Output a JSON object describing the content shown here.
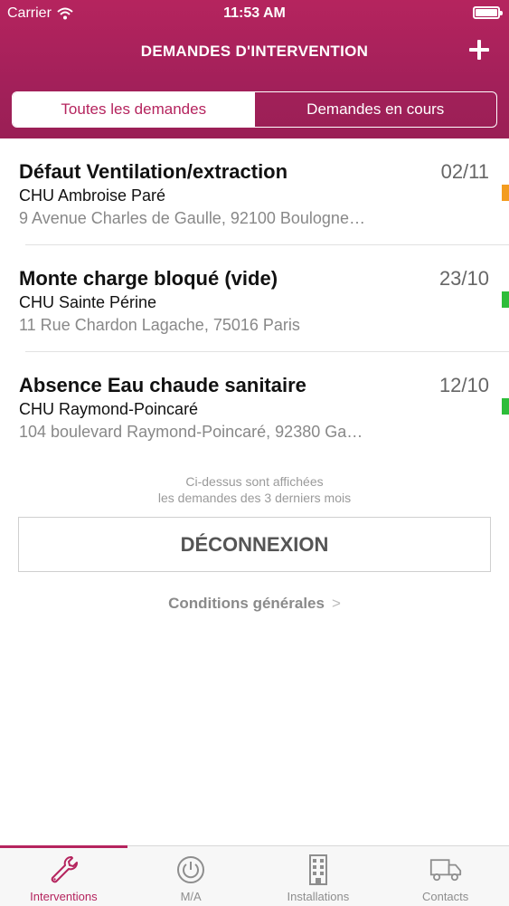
{
  "status_bar": {
    "carrier": "Carrier",
    "time": "11:53 AM"
  },
  "nav": {
    "title": "DEMANDES D'INTERVENTION",
    "add_icon": "plus-icon"
  },
  "segments": [
    {
      "label": "Toutes les demandes",
      "active": true
    },
    {
      "label": "Demandes en cours",
      "active": false
    }
  ],
  "requests": [
    {
      "title": "Défaut Ventilation/extraction",
      "date": "02/11",
      "site": "CHU Ambroise Paré",
      "address": "9 Avenue Charles de Gaulle, 92100 Boulogne…",
      "status_color": "#f39c1f"
    },
    {
      "title": "Monte charge bloqué (vide)",
      "date": "23/10",
      "site": "CHU Sainte Périne",
      "address": "11 Rue Chardon Lagache, 75016 Paris",
      "status_color": "#2ebd3a"
    },
    {
      "title": "Absence Eau chaude sanitaire",
      "date": "12/10",
      "site": "CHU Raymond-Poincaré",
      "address": "104 boulevard Raymond-Poincaré, 92380 Ga…",
      "status_color": "#2ebd3a"
    }
  ],
  "note": {
    "line1": "Ci-dessus sont affichées",
    "line2": "les demandes des 3 derniers mois"
  },
  "logout_label": "DÉCONNEXION",
  "conditions_label": "Conditions générales",
  "tabs": [
    {
      "label": "Interventions",
      "icon": "wrench-icon",
      "active": true
    },
    {
      "label": "M/A",
      "icon": "power-icon",
      "active": false
    },
    {
      "label": "Installations",
      "icon": "building-icon",
      "active": false
    },
    {
      "label": "Contacts",
      "icon": "truck-icon",
      "active": false
    }
  ],
  "colors": {
    "brand": "#b5245e",
    "status_orange": "#f39c1f",
    "status_green": "#2ebd3a"
  }
}
